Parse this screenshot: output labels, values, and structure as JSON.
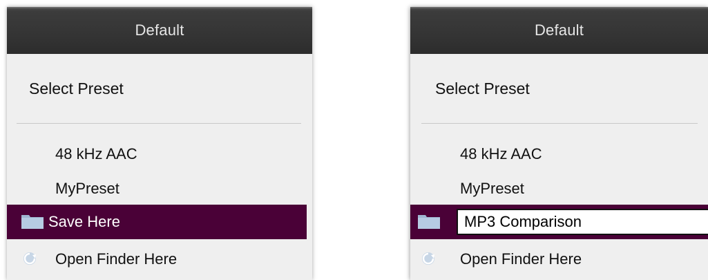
{
  "panels": [
    {
      "title": "Default",
      "select_label": "Select Preset",
      "presets": [
        "48 kHz AAC",
        "MyPreset"
      ],
      "save_label": "Save Here",
      "finder_label": "Open Finder Here"
    },
    {
      "title": "Default",
      "select_label": "Select Preset",
      "presets": [
        "48 kHz AAC",
        "MyPreset"
      ],
      "name_input_value": "MP3 Comparison",
      "finder_label": "Open Finder Here"
    }
  ],
  "icons": {
    "folder": "folder-icon",
    "open_finder": "refresh-icon"
  },
  "colors": {
    "highlight": "#4a0137",
    "titlebar": "#343434",
    "menu_bg": "#efefef"
  }
}
